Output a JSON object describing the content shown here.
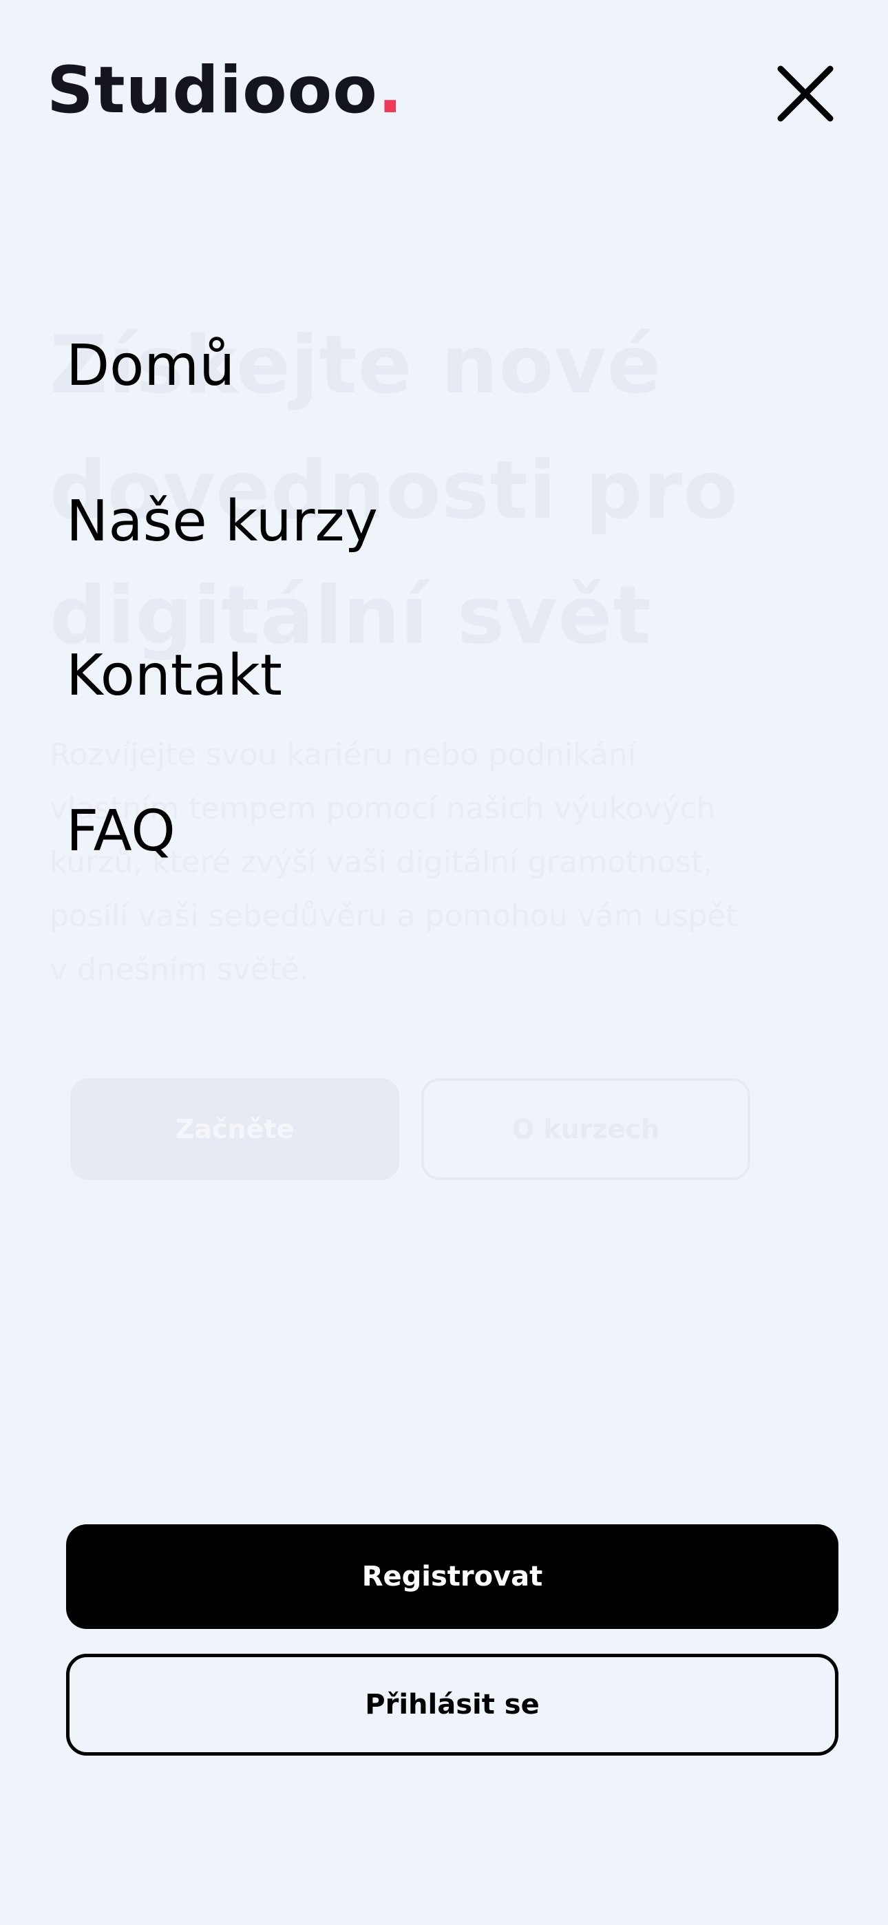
{
  "header": {
    "logo_text": "Studiooo",
    "logo_dot": ".",
    "close_icon": "close-icon"
  },
  "hero": {
    "title": "Získejte nové dovednosti pro digitální svět",
    "text": "Rozvíjejte svou kariéru nebo podnikání vlastním tempem pomocí našich výukových kurzů, které zvýší vaši digitální gramotnost, posílí vaši sebedůvěru a pomohou vám uspět v dnešním světě.",
    "primary_button": "Začněte",
    "secondary_button": "O kurzech"
  },
  "menu": {
    "items": [
      {
        "label": "Domů"
      },
      {
        "label": "Naše kurzy"
      },
      {
        "label": "Kontakt"
      },
      {
        "label": "FAQ"
      }
    ]
  },
  "actions": {
    "register_label": "Registrovat",
    "login_label": "Přihlásit se"
  },
  "colors": {
    "background": "#EFF3FA",
    "logo_text": "#14141F",
    "logo_dot": "#F03A5A",
    "primary_button": "#000000"
  }
}
